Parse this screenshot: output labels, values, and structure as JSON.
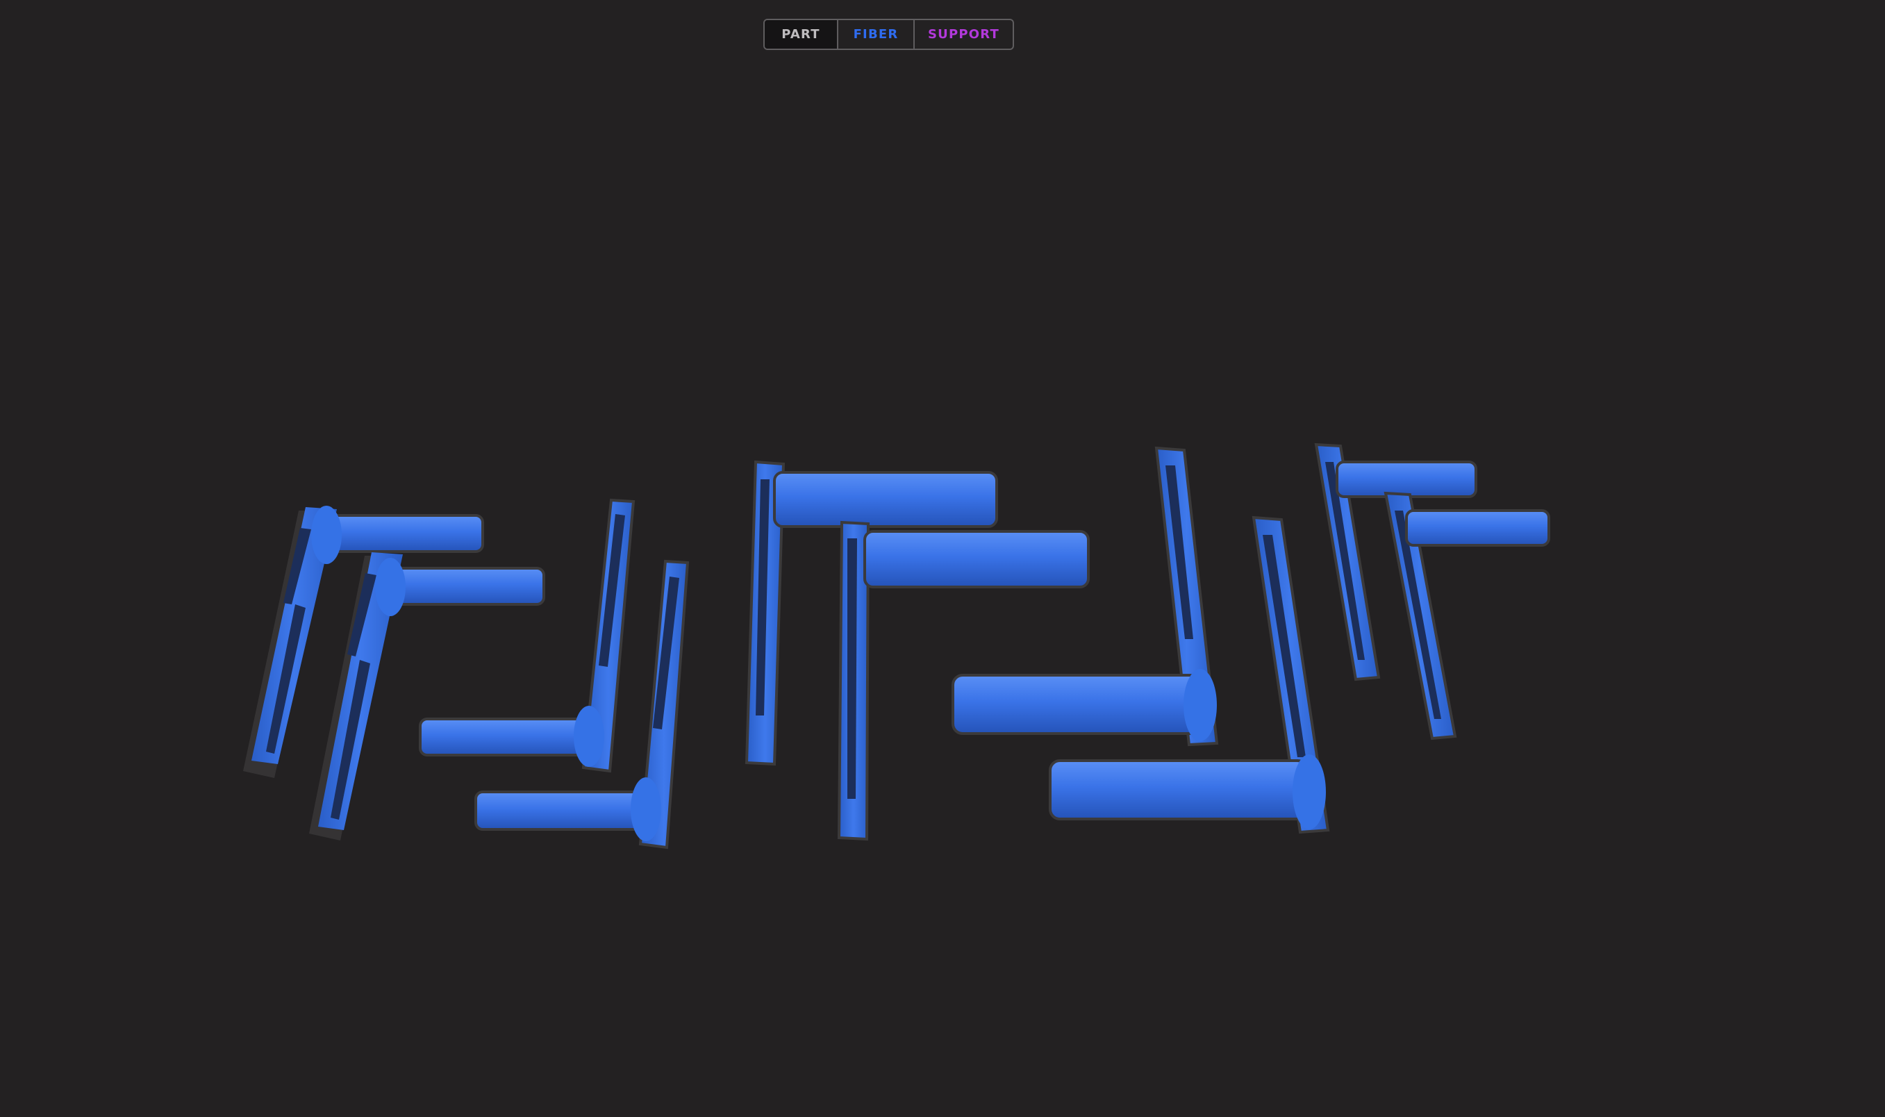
{
  "toolbar": {
    "buttons": [
      {
        "label": "PART",
        "color": "#bfbdbf"
      },
      {
        "label": "FIBER",
        "color": "#2f6cf0"
      },
      {
        "label": "SUPPORT",
        "color": "#b339dc"
      }
    ]
  },
  "viewport": {
    "background": "#232122",
    "part_color": "#3a73e8",
    "fiber_color": "#2f6cf0",
    "support_color": "#b339dc",
    "part_count": 12
  }
}
